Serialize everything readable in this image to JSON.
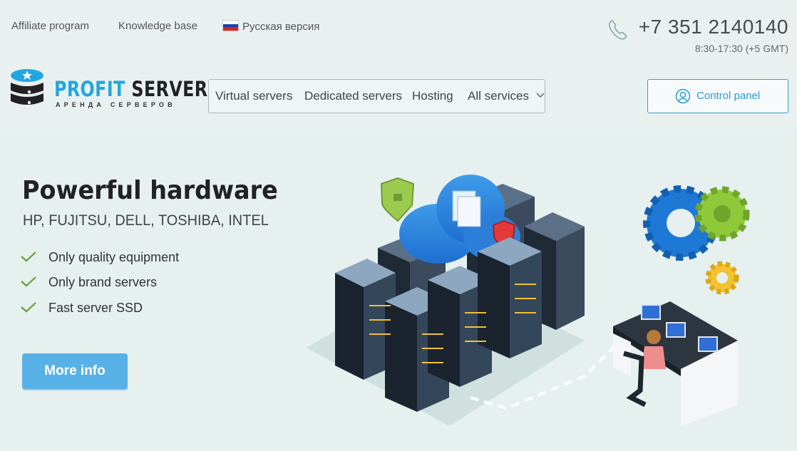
{
  "topbar": {
    "affiliate": "Affiliate program",
    "knowledge": "Knowledge base",
    "language": "Русская версия",
    "phone": "+7 351 2140140",
    "hours": "8:30-17:30 (+5 GMT)"
  },
  "logo": {
    "name_part1": "PROFIT",
    "name_part2": "SERVER",
    "subtitle": "АРЕНДА СЕРВЕРОВ"
  },
  "nav": {
    "items": [
      "Virtual servers",
      "Dedicated servers",
      "Hosting",
      "All services"
    ]
  },
  "control_panel": {
    "label": "Control panel"
  },
  "hero": {
    "title": "Powerful hardware",
    "subtitle": "HP, FUJITSU, DELL, TOSHIBA, INTEL",
    "features": [
      "Only quality equipment",
      "Only brand servers",
      "Fast server SSD"
    ],
    "button": "More info"
  },
  "colors": {
    "brand_blue": "#21a7e0",
    "button_blue": "#58b1e6",
    "check_green": "#6a9a3a",
    "background": "#e9f1f0"
  }
}
